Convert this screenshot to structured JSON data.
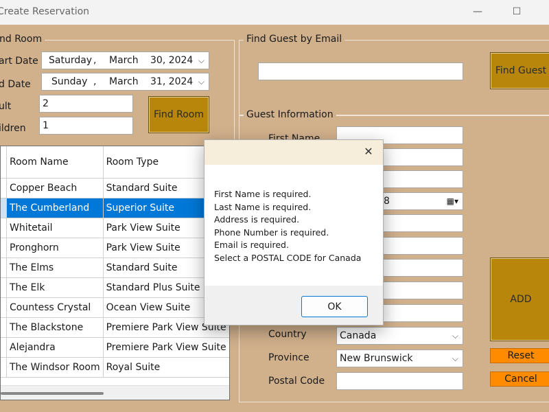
{
  "window": {
    "title": "Create Reservation",
    "minimize_glyph": "—",
    "maximize_glyph": "☐"
  },
  "find_room": {
    "legend": "nd Room",
    "start_date_label": "art Date",
    "end_date_label": "d Date",
    "adult_label": "ult",
    "children_label": "ildren",
    "start_date": {
      "weekday": "Saturday",
      "sep": ",",
      "month": "March",
      "day_year": "30, 2024"
    },
    "end_date": {
      "weekday": "Sunday",
      "sep": ",",
      "month": "March",
      "day_year": "31, 2024"
    },
    "adult_value": "2",
    "children_value": "1",
    "find_button": "Find Room"
  },
  "room_grid": {
    "headers": [
      "",
      "Room Name",
      "Room Type"
    ],
    "rows": [
      {
        "name": "Copper Beach",
        "type": "Standard Suite"
      },
      {
        "name": "The Cumberland",
        "type": "Superior Suite"
      },
      {
        "name": "Whitetail",
        "type": "Park View Suite"
      },
      {
        "name": "Pronghorn",
        "type": "Park View Suite"
      },
      {
        "name": "The Elms",
        "type": "Standard Suite"
      },
      {
        "name": "The Elk",
        "type": "Standard Plus Suite"
      },
      {
        "name": "Countess Crystal",
        "type": "Ocean View Suite"
      },
      {
        "name": "The Blackstone",
        "type": "Premiere Park View Suite"
      },
      {
        "name": "Alejandra",
        "type": "Premiere Park View Suite"
      },
      {
        "name": "The Windsor Room",
        "type": "Royal Suite"
      }
    ],
    "selected_row": 1
  },
  "find_guest": {
    "legend": "Find Guest by Email",
    "email_value": "",
    "button": "Find Guest"
  },
  "guest_info": {
    "legend": "Guest Information",
    "first_name_label": "First Name",
    "date_fragment": "8",
    "country_label": "Country",
    "country_value": "Canada",
    "province_label": "Province",
    "province_value": "New Brunswick",
    "postal_label": "Postal Code",
    "postal_value": ""
  },
  "actions": {
    "add": "ADD",
    "reset": "Reset",
    "cancel": "Cancel"
  },
  "dialog": {
    "close_glyph": "✕",
    "messages": [
      "First Name is required.",
      "Last Name is required.",
      "Address is required.",
      "Phone Number is required.",
      "Email is required.",
      "Select a POSTAL CODE for Canada"
    ],
    "ok": "OK"
  },
  "colors": {
    "window_bg": "#d1b08c",
    "gold_button": "#b8860b",
    "orange_button": "#ff8c00",
    "selection": "#0078d7"
  }
}
